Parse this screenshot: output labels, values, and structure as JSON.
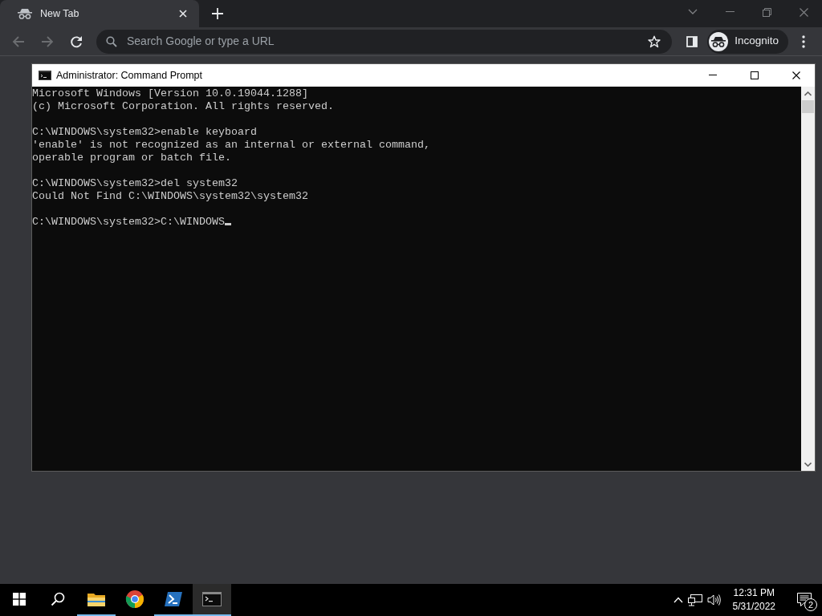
{
  "browser": {
    "tab": {
      "title": "New Tab",
      "selected": true
    },
    "nav_buttons": [
      {
        "kind": "back",
        "disabled": true
      },
      {
        "kind": "forward",
        "disabled": true
      },
      {
        "kind": "reload",
        "disabled": false
      }
    ],
    "address_bar": {
      "placeholder": "Search Google or type a URL"
    },
    "profile": {
      "label": "Incognito"
    }
  },
  "console_window": {
    "title": "Administrator: Command Prompt",
    "blocks": [
      [
        "Microsoft Windows [Version 10.0.19044.1288]",
        "(c) Microsoft Corporation. All rights reserved."
      ],
      [
        "C:\\WINDOWS\\system32>enable keyboard",
        "'enable' is not recognized as an internal or external command,",
        "operable program or batch file."
      ],
      [
        "C:\\WINDOWS\\system32>del system32",
        "Could Not Find C:\\WINDOWS\\system32\\system32"
      ]
    ],
    "prompt": "C:\\WINDOWS\\system32>C:\\WINDOWS"
  },
  "taskbar": {
    "apps": [
      {
        "kind": "folder",
        "running": true,
        "active": false
      },
      {
        "kind": "chrome",
        "running": false,
        "active": false
      },
      {
        "kind": "powershell",
        "running": true,
        "active": false
      },
      {
        "kind": "console",
        "running": true,
        "active": true
      }
    ],
    "clock": {
      "time": "12:31 PM",
      "date": "5/31/2022"
    },
    "notifications": {
      "count": "2"
    }
  }
}
